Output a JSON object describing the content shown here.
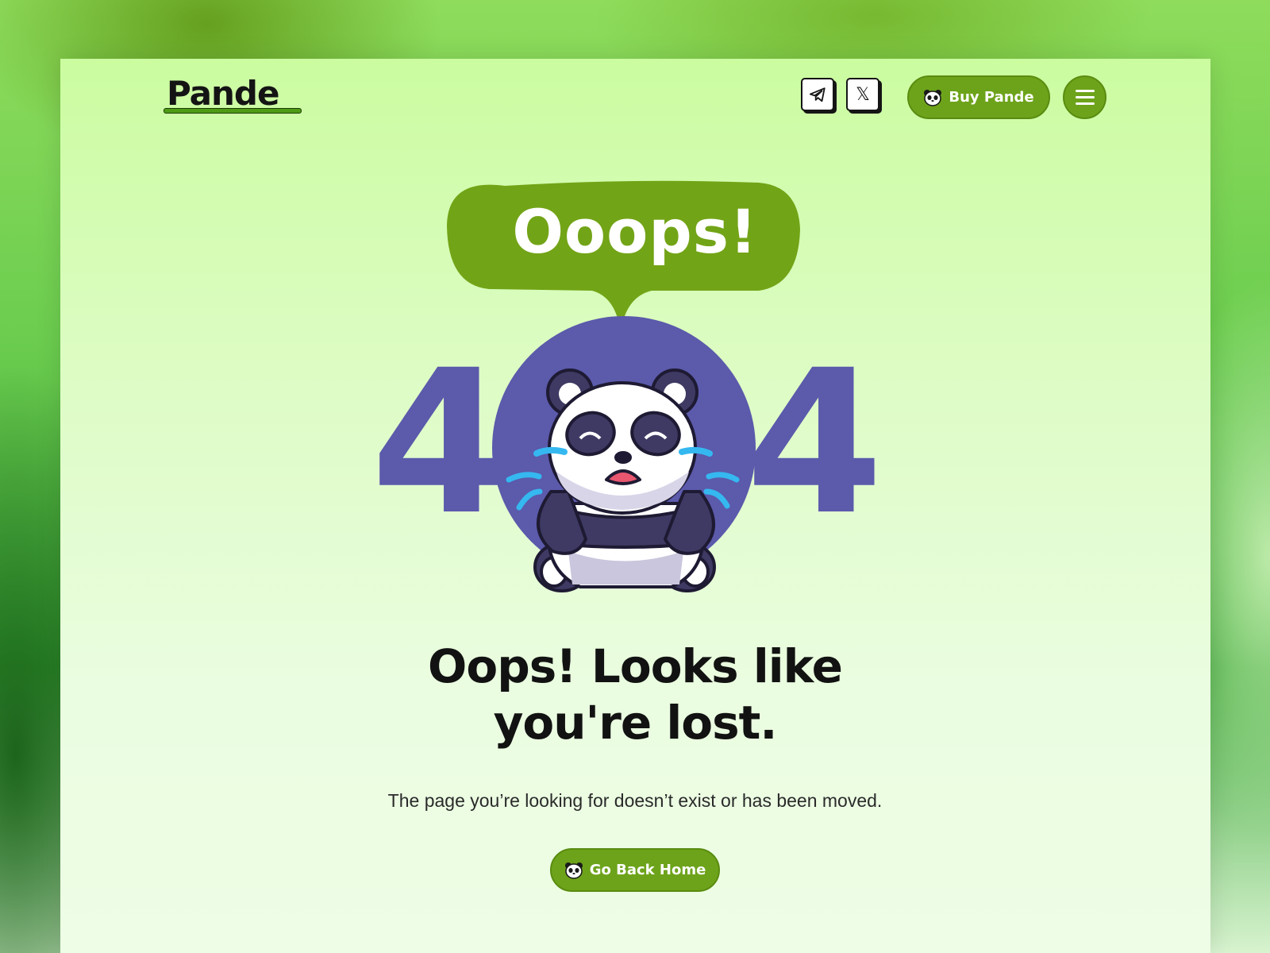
{
  "header": {
    "logo_text": "Pande",
    "buy_label": "Buy Pande",
    "social": [
      "telegram-icon",
      "x-icon"
    ],
    "x_glyph": "𝕏"
  },
  "hero": {
    "bubble_text": "Ooops!",
    "digits": [
      "4",
      "0",
      "4"
    ],
    "headline_line1": "Oops! Looks like",
    "headline_line2": "you're lost.",
    "subtext": "The page you’re looking for doesn’t exist or has been moved.",
    "cta_label": "Go Back Home"
  },
  "colors": {
    "accent_green": "#6da31a",
    "bubble_green": "#72a417",
    "purple": "#5b5aab",
    "page_bg": "#ddfcc4"
  }
}
